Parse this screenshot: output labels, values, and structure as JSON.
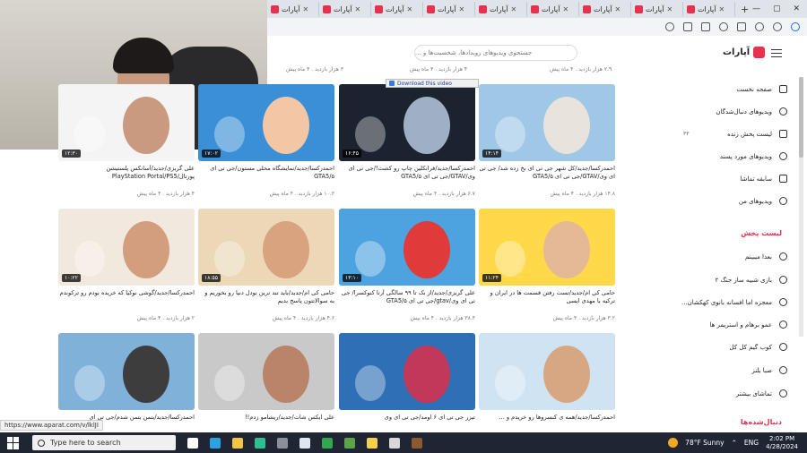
{
  "browser": {
    "tabs": [
      {
        "label": "آپارات"
      },
      {
        "label": "آپارات"
      },
      {
        "label": "آپارات"
      },
      {
        "label": "آپارات"
      },
      {
        "label": "آپارات"
      },
      {
        "label": "آپارات"
      },
      {
        "label": "آپارات"
      },
      {
        "label": "آپارات"
      },
      {
        "label": "آپارات"
      }
    ],
    "new_tab": "+",
    "window_controls": [
      "—",
      "▢",
      "✕"
    ]
  },
  "site": {
    "name": "آپارات",
    "search_placeholder": "جستجوی ویدیوهای رویدادها، شخصیت‌ها و ..."
  },
  "sidebar": {
    "items": [
      {
        "label": "صفحه نخست"
      },
      {
        "label": "ویدیوهای دنبال‌شدگان"
      },
      {
        "label": "لیست پخش زنده"
      },
      {
        "label": "ویدیوهای مورد پسند"
      },
      {
        "label": "سابقه تماشا"
      },
      {
        "label": "ویدیوهای من"
      }
    ],
    "live_count": "۳۳",
    "playlist_heading": "لیست پخش",
    "playlists": [
      {
        "label": "بعدا میبینم"
      },
      {
        "label": "بازی شبیه ساز جنگ ۲"
      },
      {
        "label": "معجزه اما افسانه بانوی کهکشان..."
      },
      {
        "label": "عمو برهام و استریمر ها"
      },
      {
        "label": "کوب گیم کل کل"
      },
      {
        "label": "صبا بلنز"
      },
      {
        "label": "تماشای بیشتر"
      }
    ],
    "following_heading": "دنبال‌شده‌ها"
  },
  "top_meta": [
    {
      "text": "۴ هزار بازدید . ۴ ماه پیش"
    },
    {
      "text": "۲.۹ هزار بازدید . ۴ ماه پیش"
    },
    {
      "text": "۳ هزار بازدید . ۴ ماه پیش"
    }
  ],
  "download_bar": "Download this video",
  "videos": [
    {
      "title": "احمدرکسا/جدید/کل شهر جی تی ای بخ زده شد/ جی تی ای وی/GTAV/جی تی ای GTA5/۵",
      "meta": "۱۴.۸ هزار بازدید . ۴ ماه پیش",
      "duration": "۱۴:۱۴",
      "bg": "#9fc7e6",
      "accent": "#e8e3dc"
    },
    {
      "title": "احمدرکسا/جدید/فرانکلین چاپ رو کشت!/جی تی ای وی/GTAV/جی تی ای GTA5/۵",
      "meta": "۶.۷ هزار بازدید . ۴ ماه پیش",
      "duration": "۱۶:۴۵",
      "bg": "#1b2330",
      "accent": "#9fb0c4"
    },
    {
      "title": "احمدرکسا/جدید/نمایشگاه محلی مستون/جی تی ای GTA5/۵",
      "meta": "۱۰.۳ هزار بازدید . ۴ ماه پیش",
      "duration": "۱۷:۰۲",
      "bg": "#3a8fd6",
      "accent": "#f3c6a6"
    },
    {
      "title": "علی گربزی/جدید/آسانکس پلستیشن پورتال/PlayStation Portal/PS5",
      "meta": "۴ هزار بازدید . ۴ ماه پیش",
      "duration": "۱۲:۳۰",
      "bg": "#f4f4f4",
      "accent": "#c99a80"
    },
    {
      "title": "حامی کی ام/جدید/تست رفتن قسمت ها در ایران و ترکیه با مهدی ایسی",
      "meta": "۳.۲ هزار بازدید . ۴ ماه پیش",
      "duration": "۱۱:۲۴",
      "bg": "#ffd94a",
      "accent": "#e5b896"
    },
    {
      "title": "علی گربزی/جدید/از بک تا ۹۹ سالگی آرتا کنوکسرا/ جی تی ای وی/gtav/جی تی ای GTA5/۵",
      "meta": "۳۸.۴ هزار بازدید . ۴ ماه پیش",
      "duration": "۱۳:۱۰",
      "bg": "#4da3e0",
      "accent": "#e03a3a"
    },
    {
      "title": "حامی کی ام/جدید/باید تند ترین نودل دنیا رو بخوریم و به سوالاتتون پاسخ بدیم",
      "meta": "۴.۶ هزار بازدید . ۴ ماه پیش",
      "duration": "۱۸:۵۵",
      "bg": "#ecd8b6",
      "accent": "#d8a37e"
    },
    {
      "title": "احمدرکسا/جدید/گوشی نوکیا که خریده بودم رو ترکوندم",
      "meta": "۲ هزار بازدید . ۴ ماه پیش",
      "duration": "۱۰:۲۲",
      "bg": "#f1e9de",
      "accent": "#d39e7e"
    },
    {
      "title": "احمدرکسا/جدید/همه ی کنسروها رو خریدم و ...",
      "meta": "",
      "duration": "",
      "bg": "#cfe3f3",
      "accent": "#d7a784"
    },
    {
      "title": "تیزر جی تی ای ۶ اومد/جی تی ای وی",
      "meta": "",
      "duration": "",
      "bg": "#2f6fb5",
      "accent": "#c2385a"
    },
    {
      "title": "علی ایکس شات/جدید/ریشامو زدم!!",
      "meta": "",
      "duration": "",
      "bg": "#c9c9c9",
      "accent": "#b98468"
    },
    {
      "title": "احمدرکسا/جدید/بتمن بتمن شدم/جی تی ای",
      "meta": "",
      "duration": "",
      "bg": "#7fb1d9",
      "accent": "#3d3d3d"
    }
  ],
  "status_url": "https://www.aparat.com/v/lklJI",
  "taskbar": {
    "search_placeholder": "Type here to search",
    "weather": "78°F  Sunny",
    "lang": "ENG",
    "time": "2:02 PM",
    "date": "4/28/2024",
    "apps": [
      {
        "name": "task-view",
        "color": "#ffffff"
      },
      {
        "name": "telegram",
        "color": "#2aa3e0"
      },
      {
        "name": "file-explorer",
        "color": "#f4c542"
      },
      {
        "name": "edge",
        "color": "#2ebf91"
      },
      {
        "name": "settings",
        "color": "#8a8f99"
      },
      {
        "name": "steam",
        "color": "#dfe6ee"
      },
      {
        "name": "xbox",
        "color": "#31a84f"
      },
      {
        "name": "minecraft",
        "color": "#5da34a"
      },
      {
        "name": "notes",
        "color": "#f5d04b"
      },
      {
        "name": "obs",
        "color": "#d8d8d8"
      },
      {
        "name": "game",
        "color": "#8c5a2e"
      }
    ]
  }
}
